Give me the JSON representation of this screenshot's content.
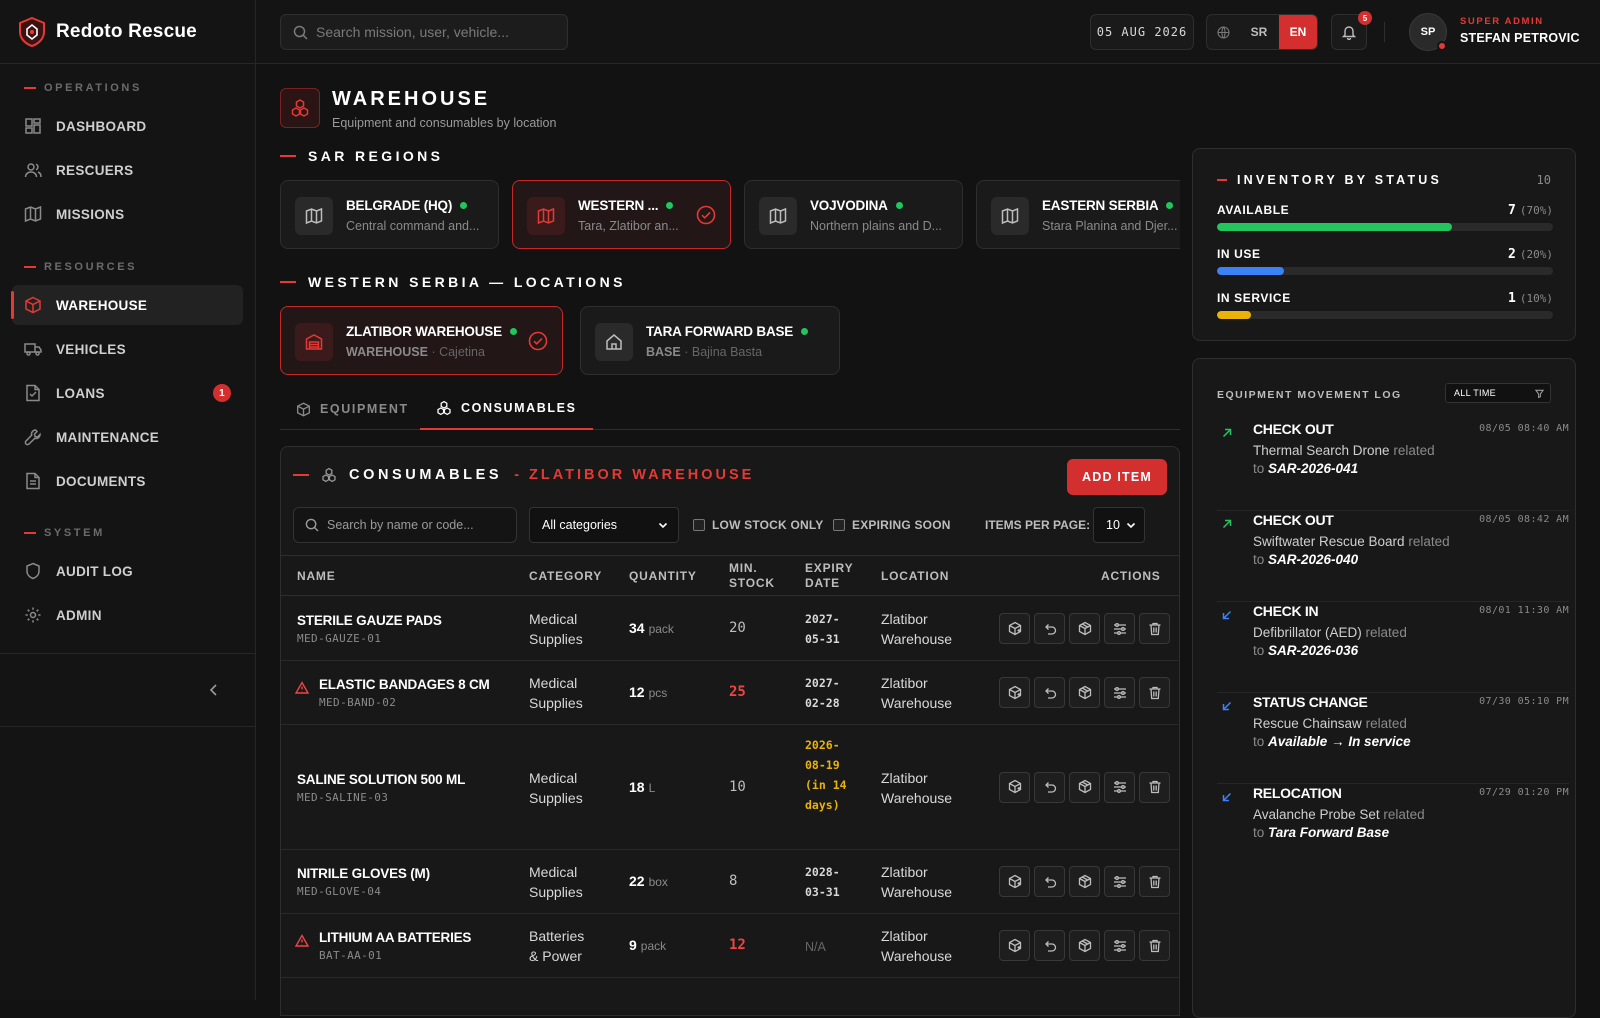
{
  "app": {
    "name": "Redoto Rescue"
  },
  "sidebar": {
    "sections": [
      {
        "label": "OPERATIONS",
        "items": [
          {
            "label": "DASHBOARD",
            "icon": "dashboard-icon"
          },
          {
            "label": "RESCUERS",
            "icon": "users-icon"
          },
          {
            "label": "MISSIONS",
            "icon": "map-icon"
          }
        ]
      },
      {
        "label": "RESOURCES",
        "items": [
          {
            "label": "WAREHOUSE",
            "icon": "box-icon",
            "active": true
          },
          {
            "label": "VEHICLES",
            "icon": "truck-icon"
          },
          {
            "label": "LOANS",
            "icon": "file-icon",
            "badge": "1"
          },
          {
            "label": "MAINTENANCE",
            "icon": "wrench-icon"
          },
          {
            "label": "DOCUMENTS",
            "icon": "document-icon"
          }
        ]
      },
      {
        "label": "SYSTEM",
        "items": [
          {
            "label": "AUDIT LOG",
            "icon": "shield-icon"
          },
          {
            "label": "ADMIN",
            "icon": "gear-icon"
          }
        ]
      }
    ]
  },
  "topbar": {
    "search_placeholder": "Search mission, user, vehicle...",
    "date": "05 AUG 2026",
    "lang_sr": "SR",
    "lang_en": "EN",
    "notifications": "5",
    "user_initials": "SP",
    "user_role": "SUPER ADMIN",
    "user_name": "STEFAN PETROVIC"
  },
  "page": {
    "title": "WAREHOUSE",
    "subtitle": "Equipment and consumables by location",
    "regions_heading": "SAR REGIONS",
    "regions": [
      {
        "name": "BELGRADE (HQ)",
        "desc": "Central command and..."
      },
      {
        "name": "WESTERN ...",
        "desc": "Tara, Zlatibor an...",
        "selected": true
      },
      {
        "name": "VOJVODINA",
        "desc": "Northern plains and D..."
      },
      {
        "name": "EASTERN SERBIA",
        "desc": "Stara Planina and Djer..."
      }
    ],
    "locations_heading": "WESTERN SERBIA — LOCATIONS",
    "locations": [
      {
        "name": "ZLATIBOR WAREHOUSE",
        "type": "WAREHOUSE",
        "place": "· Cajetina",
        "selected": true
      },
      {
        "name": "TARA FORWARD BASE",
        "type": "BASE",
        "place": "· Bajina Basta"
      }
    ],
    "tabs": [
      {
        "label": "EQUIPMENT"
      },
      {
        "label": "CONSUMABLES",
        "active": true
      }
    ]
  },
  "consumables": {
    "title": "CONSUMABLES",
    "location_suffix": "- ZLATIBOR WAREHOUSE",
    "add_label": "ADD ITEM",
    "search_placeholder": "Search by name or code...",
    "category_selected": "All categories",
    "low_stock_label": "LOW STOCK ONLY",
    "expiring_label": "EXPIRING SOON",
    "items_per_page_label": "ITEMS PER PAGE:",
    "items_per_page": "10",
    "columns": {
      "name": "NAME",
      "category": "CATEGORY",
      "quantity": "QUANTITY",
      "min1": "MIN.",
      "min2": "STOCK",
      "exp1": "EXPIRY",
      "exp2": "DATE",
      "location": "LOCATION",
      "actions": "ACTIONS"
    },
    "rows": [
      {
        "name": "STERILE GAUZE PADS",
        "code": "MED-GAUZE-01",
        "cat1": "Medical",
        "cat2": "Supplies",
        "qty": "34",
        "unit": "pack",
        "min": "20",
        "expiry": "2027-05-31",
        "loc1": "Zlatibor",
        "loc2": "Warehouse",
        "low": false
      },
      {
        "name": "ELASTIC BANDAGES 8 CM",
        "code": "MED-BAND-02",
        "cat1": "Medical",
        "cat2": "Supplies",
        "qty": "12",
        "unit": "pcs",
        "min": "25",
        "expiry": "2027-02-28",
        "loc1": "Zlatibor",
        "loc2": "Warehouse",
        "low": true
      },
      {
        "name": "SALINE SOLUTION 500 ML",
        "code": "MED-SALINE-03",
        "cat1": "Medical",
        "cat2": "Supplies",
        "qty": "18",
        "unit": "L",
        "min": "10",
        "expiry": "2026-08-19 (in 14 days)",
        "loc1": "Zlatibor",
        "loc2": "Warehouse",
        "low": false,
        "expiring": true
      },
      {
        "name": "NITRILE GLOVES (M)",
        "code": "MED-GLOVE-04",
        "cat1": "Medical",
        "cat2": "Supplies",
        "qty": "22",
        "unit": "box",
        "min": "8",
        "expiry": "2028-03-31",
        "loc1": "Zlatibor",
        "loc2": "Warehouse",
        "low": false
      },
      {
        "name": "LITHIUM AA BATTERIES",
        "code": "BAT-AA-01",
        "cat1": "Batteries",
        "cat2": "& Power",
        "qty": "9",
        "unit": "pack",
        "min": "12",
        "expiry": "N/A",
        "loc1": "Zlatibor",
        "loc2": "Warehouse",
        "low": true
      }
    ]
  },
  "inventory": {
    "title": "INVENTORY BY STATUS",
    "total": "10",
    "statuses": [
      {
        "label": "AVAILABLE",
        "count": "7",
        "pct": "(70%)",
        "fraction": 0.7,
        "color": "#22c55e"
      },
      {
        "label": "IN USE",
        "count": "2",
        "pct": "(20%)",
        "fraction": 0.2,
        "color": "#3b82f6"
      },
      {
        "label": "IN SERVICE",
        "count": "1",
        "pct": "(10%)",
        "fraction": 0.1,
        "color": "#eab308"
      }
    ]
  },
  "movement_log": {
    "title": "EQUIPMENT MOVEMENT LOG",
    "filter": "ALL TIME",
    "related": "related",
    "to": "to",
    "events": [
      {
        "type": "CHECK OUT",
        "time": "08/05 08:40 AM",
        "item": "Thermal Search Drone",
        "target": "SAR-2026-041",
        "dir": "out"
      },
      {
        "type": "CHECK OUT",
        "time": "08/05 08:42 AM",
        "item": "Swiftwater Rescue Board",
        "target": "SAR-2026-040",
        "dir": "out"
      },
      {
        "type": "CHECK IN",
        "time": "08/01 11:30 AM",
        "item": "Defibrillator (AED)",
        "target": "SAR-2026-036",
        "dir": "in"
      },
      {
        "type": "STATUS CHANGE",
        "time": "07/30 05:10 PM",
        "item": "Rescue Chainsaw",
        "target": "Available → In service",
        "dir": "in"
      },
      {
        "type": "RELOCATION",
        "time": "07/29 01:20 PM",
        "item": "Avalanche Probe Set",
        "target": "Tara Forward Base",
        "dir": "in"
      }
    ]
  }
}
